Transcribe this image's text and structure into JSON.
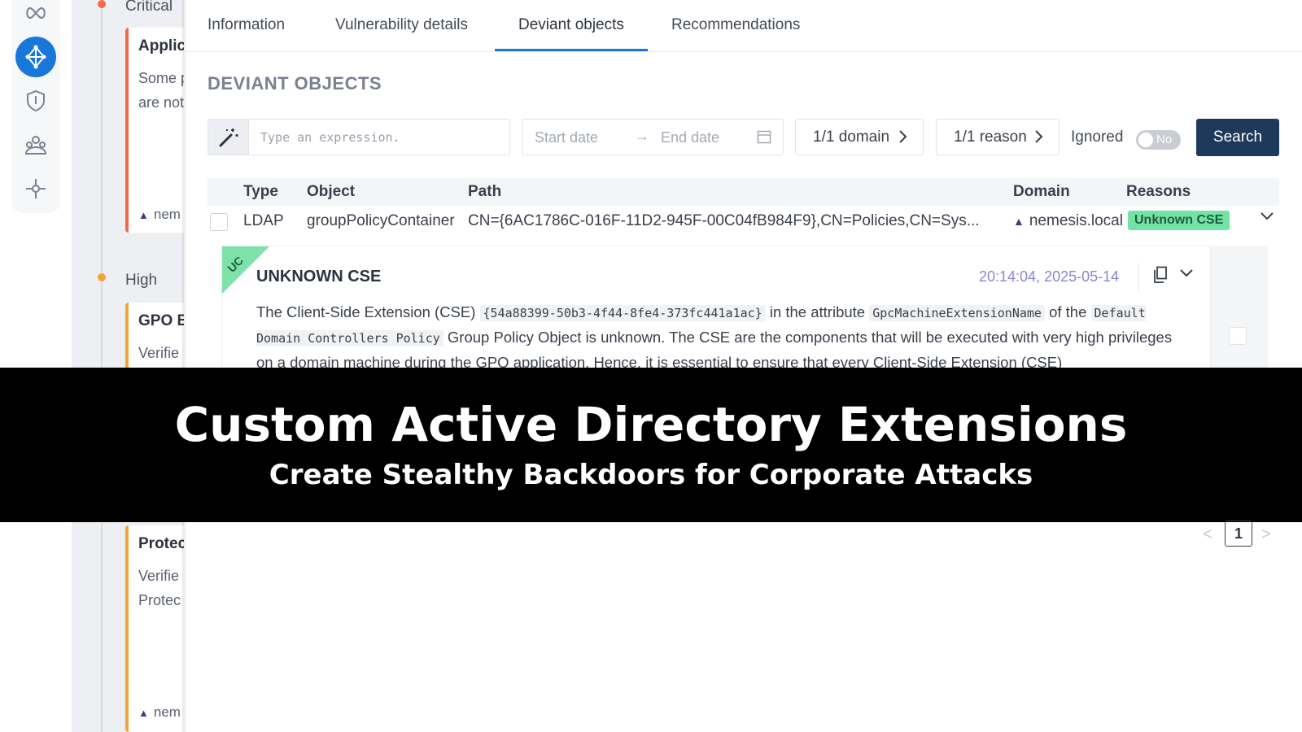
{
  "rail": {
    "icons": [
      "infinity-icon",
      "network-icon",
      "shield-icon",
      "users-icon",
      "topology-icon"
    ]
  },
  "timeline": {
    "critical_label": "Critical",
    "high_label": "High",
    "cards": [
      {
        "title": "Applic",
        "lines": [
          "Some p",
          "are not"
        ],
        "domain": "nem"
      },
      {
        "title": "GPO E",
        "lines": [
          "Verifie"
        ],
        "domain": ""
      },
      {
        "title": "Protec",
        "lines": [
          "Verifie",
          "Protec"
        ],
        "domain": "nem"
      }
    ]
  },
  "tabs": [
    {
      "label": "Information"
    },
    {
      "label": "Vulnerability details"
    },
    {
      "label": "Deviant objects"
    },
    {
      "label": "Recommendations"
    }
  ],
  "section_title": "DEVIANT OBJECTS",
  "filters": {
    "expression_placeholder": "Type an expression.",
    "start_date_placeholder": "Start date",
    "end_date_placeholder": "End date",
    "domain_filter": "1/1 domain",
    "reason_filter": "1/1 reason",
    "ignored_label": "Ignored",
    "ignored_toggle": "No",
    "search_label": "Search"
  },
  "table": {
    "headers": [
      "Type",
      "Object",
      "Path",
      "Domain",
      "Reasons"
    ],
    "rows": [
      {
        "type": "LDAP",
        "object": "groupPolicyContainer",
        "path": "CN={6AC1786C-016F-11D2-945F-00C04fB984F9},CN=Policies,CN=Sys...",
        "domain": "nemesis.local",
        "reason": "Unknown CSE"
      }
    ]
  },
  "detail": {
    "corner_badge": "UC",
    "title": "UNKNOWN CSE",
    "timestamp": "20:14:04, 2025-05-14",
    "text_1": "The Client-Side Extension (CSE)",
    "code_1": "{54a88399-50b3-4f44-8fe4-373fc441a1ac}",
    "text_2": "in the attribute",
    "code_2": "GpcMachineExtensionName",
    "text_3": "of the",
    "code_3": "Default Domain Controllers Policy",
    "text_4": "Group Policy Object is unknown. The CSE are the components that will be executed with very high privileges on a domain machine during the GPO application. Hence, it is essential to ensure that every Client-Side Extension (CSE)"
  },
  "banner": {
    "title": "Custom Active Directory Extensions",
    "subtitle": "Create Stealthy Backdoors for Corporate Attacks"
  },
  "pagination": {
    "prev": "<",
    "current": "1",
    "next": ">"
  },
  "colors": {
    "accent": "#1877d8",
    "search_button": "#1e3a5a",
    "reason_badge": "#72e3a4",
    "critical": "#ef6a4b",
    "high": "#f4a23c",
    "timestamp": "#8b86d6"
  }
}
